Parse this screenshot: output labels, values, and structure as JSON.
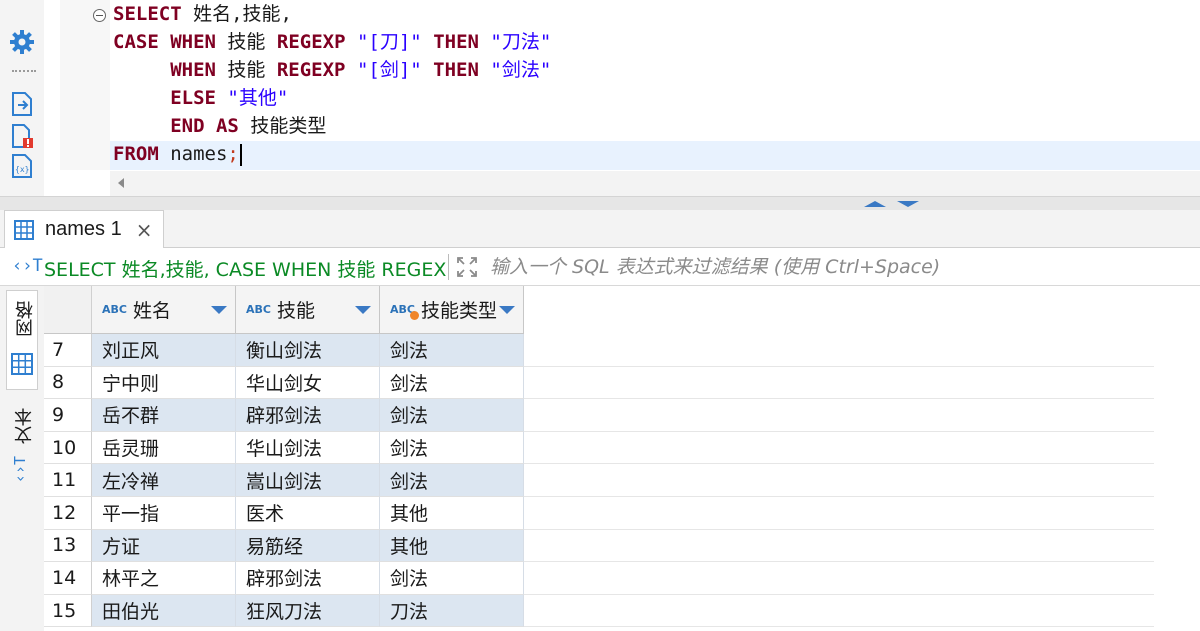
{
  "editor": {
    "lines": [
      {
        "parts": [
          {
            "t": "SELECT",
            "c": "kw"
          },
          {
            "t": " 姓名,技能,",
            "c": "id"
          }
        ]
      },
      {
        "parts": [
          {
            "t": "CASE",
            "c": "kw"
          },
          {
            "t": " ",
            "c": "id"
          },
          {
            "t": "WHEN",
            "c": "kw"
          },
          {
            "t": " 技能 ",
            "c": "id"
          },
          {
            "t": "REGEXP",
            "c": "kw"
          },
          {
            "t": " ",
            "c": "id"
          },
          {
            "t": "\"[刀]\"",
            "c": "str"
          },
          {
            "t": " ",
            "c": "id"
          },
          {
            "t": "THEN",
            "c": "kw"
          },
          {
            "t": " ",
            "c": "id"
          },
          {
            "t": "\"刀法\"",
            "c": "str"
          }
        ]
      },
      {
        "parts": [
          {
            "t": "     ",
            "c": "id"
          },
          {
            "t": "WHEN",
            "c": "kw"
          },
          {
            "t": " 技能 ",
            "c": "id"
          },
          {
            "t": "REGEXP",
            "c": "kw"
          },
          {
            "t": " ",
            "c": "id"
          },
          {
            "t": "\"[剑]\"",
            "c": "str"
          },
          {
            "t": " ",
            "c": "id"
          },
          {
            "t": "THEN",
            "c": "kw"
          },
          {
            "t": " ",
            "c": "id"
          },
          {
            "t": "\"剑法\"",
            "c": "str"
          }
        ]
      },
      {
        "parts": [
          {
            "t": "     ",
            "c": "id"
          },
          {
            "t": "ELSE",
            "c": "kw"
          },
          {
            "t": " ",
            "c": "id"
          },
          {
            "t": "\"其他\"",
            "c": "str"
          }
        ]
      },
      {
        "parts": [
          {
            "t": "     ",
            "c": "id"
          },
          {
            "t": "END",
            "c": "kw"
          },
          {
            "t": " ",
            "c": "id"
          },
          {
            "t": "AS",
            "c": "kw"
          },
          {
            "t": " 技能类型",
            "c": "id"
          }
        ]
      },
      {
        "parts": [
          {
            "t": "FROM",
            "c": "kw"
          },
          {
            "t": " names",
            "c": "id"
          },
          {
            "t": ";",
            "c": "semi"
          }
        ]
      }
    ]
  },
  "toolbar_icons": [
    "settings-icon",
    "execute-script-icon",
    "problem-file-icon",
    "variables-icon"
  ],
  "results": {
    "tab_label": "names 1",
    "tab_close": "×",
    "filter_query": "SELECT 姓名,技能, CASE WHEN 技能 REGEX",
    "filter_placeholder": "输入一个 SQL 表达式来过滤结果 (使用 Ctrl+Space)",
    "side_tabs": {
      "grid": "网格",
      "text": "文本"
    },
    "columns": [
      {
        "type_badge": "ABC",
        "label": "姓名",
        "calculated": false
      },
      {
        "type_badge": "ABC",
        "label": "技能",
        "calculated": false
      },
      {
        "type_badge": "ABC",
        "label": "技能类型",
        "calculated": true
      }
    ],
    "rows": [
      {
        "num": "7",
        "values": [
          "刘正风",
          "衡山剑法",
          "剑法"
        ],
        "shaded": true
      },
      {
        "num": "8",
        "values": [
          "宁中则",
          "华山剑女",
          "剑法"
        ],
        "shaded": false
      },
      {
        "num": "9",
        "values": [
          "岳不群",
          "辟邪剑法",
          "剑法"
        ],
        "shaded": true
      },
      {
        "num": "10",
        "values": [
          "岳灵珊",
          "华山剑法",
          "剑法"
        ],
        "shaded": false
      },
      {
        "num": "11",
        "values": [
          "左冷禅",
          "嵩山剑法",
          "剑法"
        ],
        "shaded": true
      },
      {
        "num": "12",
        "values": [
          "平一指",
          "医术",
          "其他"
        ],
        "shaded": false
      },
      {
        "num": "13",
        "values": [
          "方证",
          "易筋经",
          "其他"
        ],
        "shaded": true
      },
      {
        "num": "14",
        "values": [
          "林平之",
          "辟邪剑法",
          "剑法"
        ],
        "shaded": false
      },
      {
        "num": "15",
        "values": [
          "田伯光",
          "狂风刀法",
          "刀法"
        ],
        "shaded": true
      }
    ]
  }
}
